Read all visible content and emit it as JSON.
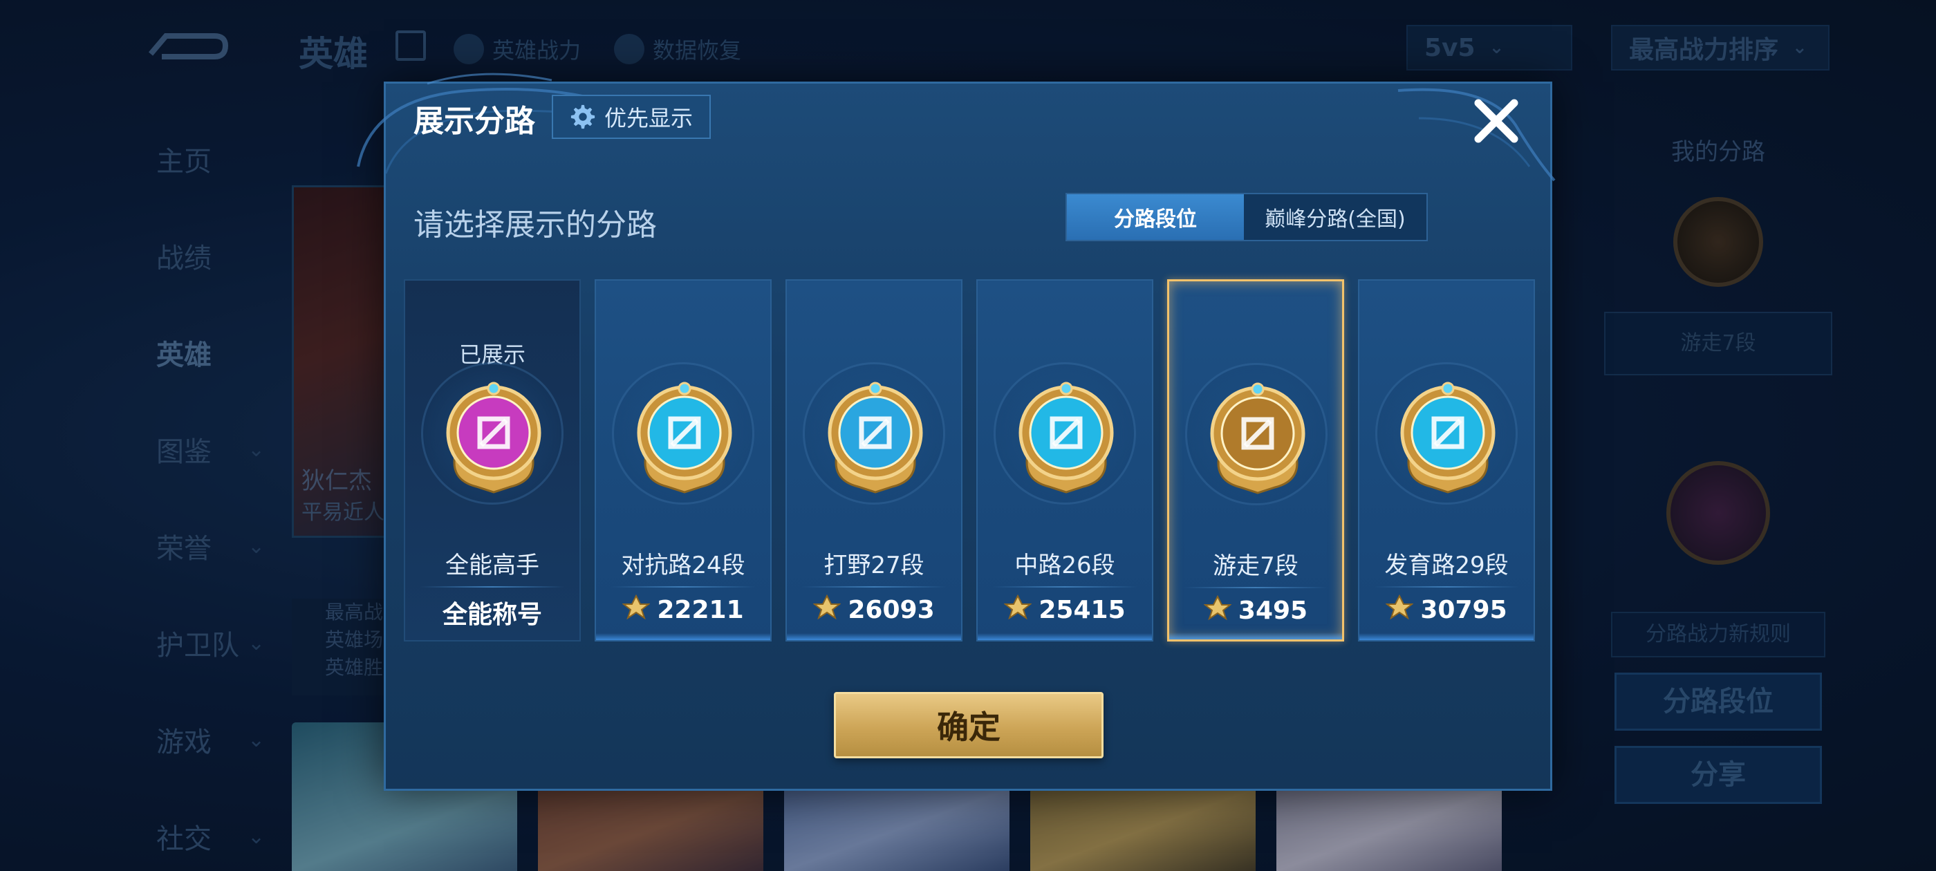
{
  "background": {
    "header_title": "英雄",
    "header_links": [
      "英雄战力",
      "数据恢复"
    ],
    "mode_dropdown": "5v5",
    "sort_dropdown": "最高战力排序",
    "nav": [
      {
        "label": "主页",
        "arrow": false
      },
      {
        "label": "战绩",
        "arrow": false
      },
      {
        "label": "英雄",
        "arrow": false,
        "active": true
      },
      {
        "label": "图鉴",
        "arrow": true
      },
      {
        "label": "荣誉",
        "arrow": true
      },
      {
        "label": "护卫队",
        "arrow": true
      },
      {
        "label": "游戏",
        "arrow": true
      },
      {
        "label": "社交",
        "arrow": true
      }
    ],
    "hero_name": "狄仁杰",
    "hero_sub": "平易近人",
    "hero_info": [
      "最高战",
      "英雄场",
      "英雄胜"
    ],
    "right_panel": {
      "title": "我的分路",
      "badge": "游走7段",
      "rule": "分路战力新规则",
      "rank_button": "分路段位",
      "share_button": "分享"
    }
  },
  "dialog": {
    "title": "展示分路",
    "priority_button": "优先显示",
    "prompt": "请选择展示的分路",
    "tabs": [
      "分路段位",
      "巅峰分路(全国)"
    ],
    "active_tab": 0,
    "confirm": "确定",
    "cards": [
      {
        "shown_label": "已展示",
        "name": "全能高手",
        "score": "全能称号",
        "icon": "all-round-medal-icon",
        "color": "#c73bbf",
        "type": "title"
      },
      {
        "shown_label": "",
        "name": "对抗路24段",
        "score": "22211",
        "icon": "clash-lane-medal-icon",
        "color": "#22b8e6",
        "type": "lane"
      },
      {
        "shown_label": "",
        "name": "打野27段",
        "score": "26093",
        "icon": "jungle-medal-icon",
        "color": "#2aa6e0",
        "type": "lane"
      },
      {
        "shown_label": "",
        "name": "中路26段",
        "score": "25415",
        "icon": "mid-lane-medal-icon",
        "color": "#22b8e6",
        "type": "lane"
      },
      {
        "shown_label": "",
        "name": "游走7段",
        "score": "3495",
        "icon": "roam-medal-icon",
        "color": "#b07b2b",
        "type": "lane",
        "selected": true
      },
      {
        "shown_label": "",
        "name": "发育路29段",
        "score": "30795",
        "icon": "farm-lane-medal-icon",
        "color": "#22b8e6",
        "type": "lane"
      }
    ]
  }
}
